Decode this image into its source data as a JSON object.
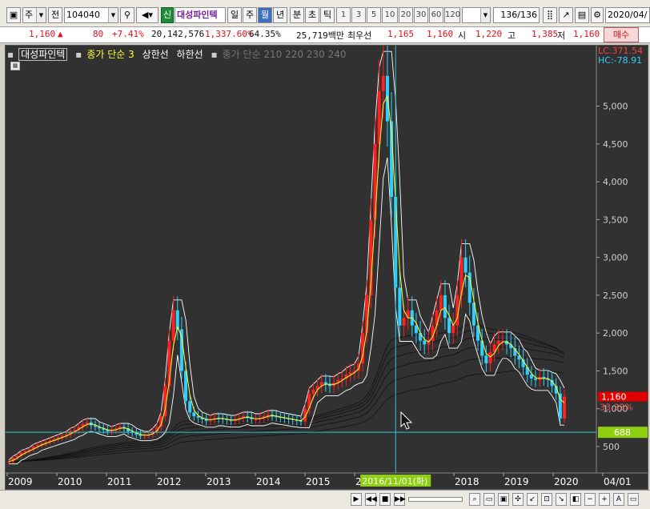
{
  "toolbar": {
    "period_label": "주",
    "jeon_label": "전",
    "code": "104040",
    "sin_label": "신",
    "name": "대성파인텍",
    "tabs": [
      "일",
      "주",
      "월",
      "년"
    ],
    "active_tab": "월",
    "time_tabs": [
      "분",
      "초",
      "틱"
    ],
    "numbers": [
      "1",
      "3",
      "5",
      "10",
      "20",
      "30",
      "60",
      "120"
    ],
    "count": "136",
    "count_total": "/136",
    "date": "2020/04/"
  },
  "quote": {
    "price": "1,160",
    "change_arrow": "▲",
    "change": "80",
    "change_pct": "+7.41%",
    "volume": "20,142,576",
    "vol_ratio": "1,337.60%",
    "turnover": "64.35%",
    "amount": "25,719백만",
    "low_label": "최우선",
    "best": "1,165",
    "best2": "1,160",
    "open_label": "시",
    "open": "1,220",
    "high_label": "고",
    "high": "1,385",
    "low2_label": "저",
    "low2": "1,160",
    "buy_button": "매수"
  },
  "legend": {
    "name": "대성파인텍",
    "ma": "종가 단순 3",
    "upper": "상한선",
    "lower": "하한선",
    "ma_multi": "종가 단순 210 220 230 240"
  },
  "colors": {
    "background": "#313131",
    "up": "#ff2020",
    "down": "#2fd0ff",
    "ma": "#ffff33",
    "envelope": "#ffffff",
    "long_ma": "#111111",
    "crosshair": "#2ec7d6",
    "current_price_bg": "#e00000",
    "crosshair_price_bg": "#8ecf12",
    "date_tag_bg": "#8ecf12"
  },
  "chart_data": {
    "type": "candlestick",
    "x_ticks": [
      "2009",
      "2010",
      "2011",
      "2012",
      "2013",
      "2014",
      "2015",
      "20",
      "2018",
      "2019",
      "2020",
      "04/01"
    ],
    "y_ticks": [
      "500",
      "1,000",
      "1,500",
      "2,000",
      "2,500",
      "3,000",
      "3,500",
      "4,000",
      "4,500",
      "5,000"
    ],
    "y_tick_values": [
      500,
      1000,
      1500,
      2000,
      2500,
      3000,
      3500,
      4000,
      4500,
      5000
    ],
    "ylim": [
      150,
      5800
    ],
    "lc_label": "LC:371.54",
    "hc_label": "HC:-78.91",
    "current_price": "1,160",
    "current_pct": "33.33%",
    "crosshair_price": "688",
    "crosshair_value": 688,
    "crosshair_date": "2016/11/01(화)",
    "series_close_monthly": [
      {
        "period": "2009",
        "values": [
          300,
          350,
          380,
          420,
          440,
          460,
          500,
          520,
          540,
          560,
          580,
          600
        ]
      },
      {
        "period": "2010",
        "values": [
          620,
          640,
          660,
          700,
          720,
          760,
          800,
          820,
          780,
          760,
          740,
          720
        ]
      },
      {
        "period": "2011",
        "values": [
          700,
          720,
          740,
          760,
          740,
          700,
          680,
          660,
          640,
          650,
          660,
          700
        ]
      },
      {
        "period": "2012",
        "values": [
          760,
          900,
          1300,
          1900,
          2300,
          2050,
          1500,
          1100,
          950,
          900,
          880,
          860
        ]
      },
      {
        "period": "2013",
        "values": [
          840,
          860,
          880,
          870,
          860,
          850,
          840,
          860,
          880,
          900,
          880,
          860
        ]
      },
      {
        "period": "2014",
        "values": [
          860,
          880,
          900,
          920,
          900,
          890,
          880,
          870,
          860,
          850,
          840,
          830
        ]
      },
      {
        "period": "2015",
        "values": [
          1000,
          1200,
          1250,
          1300,
          1350,
          1320,
          1300,
          1340,
          1380,
          1400,
          1450,
          1480
        ]
      },
      {
        "period": "2016",
        "values": [
          1500,
          1600,
          2000,
          2500,
          3500,
          4500,
          5200,
          5400,
          4800,
          3800,
          2600,
          2100
        ]
      },
      {
        "period": "2017",
        "values": [
          2200,
          2300,
          2100,
          2000,
          1900,
          1850,
          1900,
          2100,
          2300,
          2500,
          2200,
          2000
        ]
      },
      {
        "period": "2018",
        "values": [
          2100,
          2500,
          3000,
          2800,
          2400,
          2100,
          1900,
          1700,
          1600,
          1750,
          1850,
          1900
        ]
      },
      {
        "period": "2019",
        "values": [
          1900,
          1850,
          1800,
          1700,
          1650,
          1550,
          1450,
          1400,
          1380,
          1420,
          1400,
          1380
        ]
      },
      {
        "period": "2020",
        "values": [
          1300,
          1200,
          870,
          1160
        ]
      }
    ]
  }
}
